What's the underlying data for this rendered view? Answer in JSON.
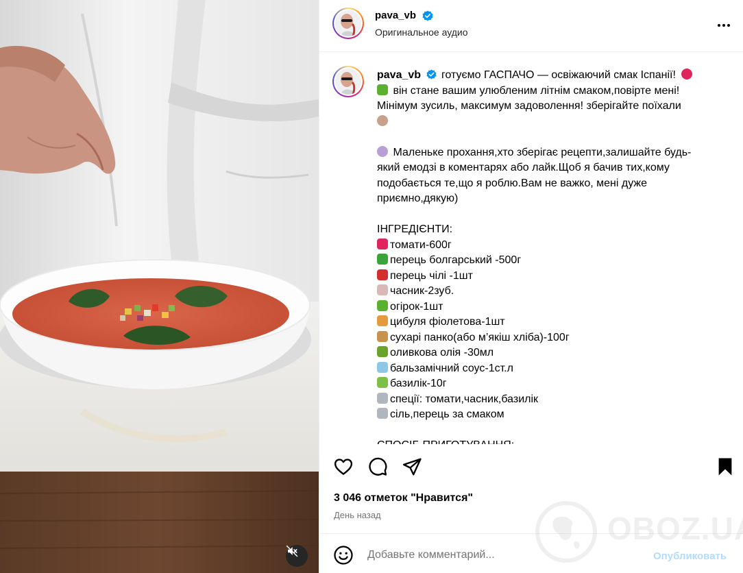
{
  "header": {
    "username": "pava_vb",
    "audio_label": "Оригинальное аудио"
  },
  "caption": {
    "username": "pava_vb",
    "intro_lines": [
      "готуємо ГАСПАЧО — освіжаючий смак Іспанії!",
      "він стане вашим улюбленим літнім смаком,повірте мені!",
      "Мінімум зусиль, максимум задоволення! зберігайте поїхали"
    ],
    "request_lines": [
      "Маленьке прохання,хто зберігає рецепти,залишайте будь-",
      "який емодзі в коментарях або лайк.Щоб я бачив тих,кому",
      "подобається те,що я роблю.Вам не важко, мені дуже",
      "приємно,дякую)"
    ],
    "ingredients_title": "ІНГРЕДІЄНТИ:",
    "ingredients": [
      {
        "text": "томати-600г",
        "color": "#e0245e"
      },
      {
        "text": "перець болгарський -500г",
        "color": "#3aa33a"
      },
      {
        "text": "перець чілі -1шт",
        "color": "#d32f2f"
      },
      {
        "text": "часник-2зуб.",
        "color": "#d9b8b8"
      },
      {
        "text": "огірок-1шт",
        "color": "#5cb030"
      },
      {
        "text": "цибуля фіолетова-1шт",
        "color": "#e39b3d"
      },
      {
        "text": "сухарі панко(або м’якіш хліба)-100г",
        "color": "#c8924a"
      },
      {
        "text": "оливкова олія -30мл",
        "color": "#6aa32c"
      },
      {
        "text": "бальзамічний соус-1ст.л",
        "color": "#8fc7e6"
      },
      {
        "text": "базилік-10г",
        "color": "#7cc04a"
      },
      {
        "text": "спеції: томати,часник,базилік",
        "color": "#b0b6bd"
      },
      {
        "text": "сіль,перець за смаком",
        "color": "#b0b6bd"
      }
    ],
    "method_title": "СПОСІБ ПРИГОТУВАННЯ:"
  },
  "actions": {
    "likes": "3 046 отметок \"Нравится\"",
    "timestamp": "День назад"
  },
  "comment": {
    "placeholder": "Добавьте комментарий...",
    "publish_label": "Опубликовать"
  },
  "watermark": {
    "text": "OBOZ.UA"
  },
  "colors": {
    "verified": "#0095f6",
    "publish_disabled": "#b3dbff",
    "secondary_text": "#737373"
  }
}
